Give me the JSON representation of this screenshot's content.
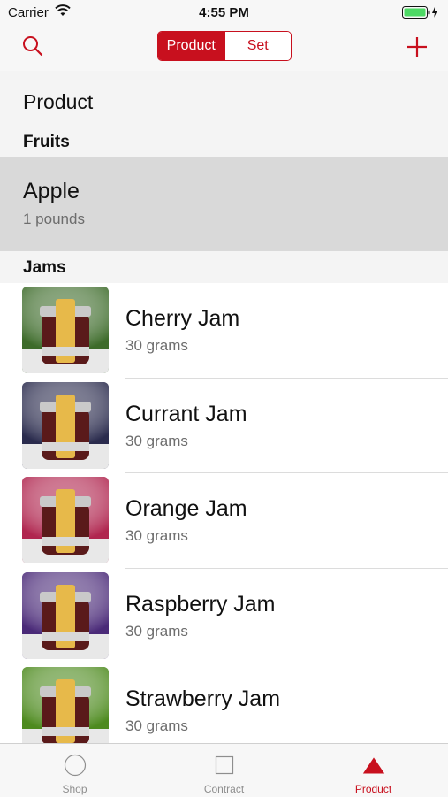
{
  "status_bar": {
    "carrier": "Carrier",
    "time": "4:55 PM"
  },
  "nav": {
    "segments": [
      "Product",
      "Set"
    ],
    "selected_segment": "Product",
    "accent_color": "#c8101e"
  },
  "page": {
    "header": "Product"
  },
  "sections": {
    "fruits": {
      "title": "Fruits",
      "items": [
        {
          "name": "Apple",
          "quantity": "1 pounds"
        }
      ]
    },
    "jams": {
      "title": "Jams",
      "items": [
        {
          "name": "Cherry Jam",
          "quantity": "30 grams",
          "thumb_color": "#3d6b2a"
        },
        {
          "name": "Currant Jam",
          "quantity": "30 grams",
          "thumb_color": "#2a2b4d"
        },
        {
          "name": "Orange Jam",
          "quantity": "30 grams",
          "thumb_color": "#b0264f"
        },
        {
          "name": "Raspberry Jam",
          "quantity": "30 grams",
          "thumb_color": "#4a2a78"
        },
        {
          "name": "Strawberry Jam",
          "quantity": "30 grams",
          "thumb_color": "#4d8a1e"
        }
      ]
    }
  },
  "tab_bar": {
    "tabs": [
      {
        "label": "Shop",
        "icon": "circle-icon"
      },
      {
        "label": "Contract",
        "icon": "square-icon"
      },
      {
        "label": "Product",
        "icon": "triangle-icon"
      }
    ],
    "selected": "Product"
  }
}
